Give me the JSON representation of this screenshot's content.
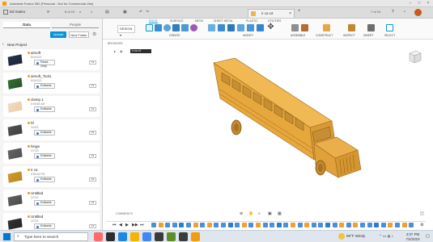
{
  "app": {
    "title": "Autodesk Fusion 360 (Personal - Not for Commercial Use)",
    "team": "Ed mateo",
    "page_counter": "8 of 10",
    "doc_tab": "ir ca v2",
    "doc_counter": "7 of 10"
  },
  "left_panel": {
    "tabs": [
      "Data",
      "People"
    ],
    "upload": "Upload",
    "new_folder": "New Folder",
    "breadcrumb": "New Project",
    "items": [
      {
        "name": "airsoft",
        "version": "8/4/1023",
        "badge": "Read-Only",
        "vb": "V1"
      },
      {
        "name": "airsoft_Tool1",
        "version": "8/4/1023",
        "badge": "Editable",
        "vb": "V1"
      },
      {
        "name": "clamp 1",
        "version": "8:55:58 AM",
        "badge": "Editable",
        "vb": "V1"
      },
      {
        "name": "hf",
        "version": "3/4/23",
        "badge": "Editable",
        "vb": "V1"
      },
      {
        "name": "hinge",
        "version": "2/7/23",
        "badge": "Editable",
        "vb": "V1"
      },
      {
        "name": "ir ca",
        "version": "8:56:18 PM",
        "badge": "Editable",
        "vb": "V2"
      },
      {
        "name": "Untitled",
        "version": "2/7/23",
        "badge": "Editable",
        "vb": "V1"
      },
      {
        "name": "Untitled",
        "version": "2/7/23",
        "badge": "Editable",
        "vb": "V1"
      }
    ]
  },
  "toolbar": {
    "workspace": "DESIGN",
    "tabs": [
      "SOLID",
      "SURFACE",
      "MESH",
      "SHEET METAL",
      "PLASTIC",
      "UTILITIES"
    ],
    "groups": [
      "CREATE",
      "MODIFY",
      "ASSEMBLE",
      "CONSTRUCT",
      "INSPECT",
      "INSERT",
      "SELECT"
    ]
  },
  "browser": {
    "label": "BROWSER",
    "node": "ir ca v2"
  },
  "comments": "COMMENTS",
  "taskbar": {
    "search": "Type here to search",
    "weather": "99°F  Windy",
    "time": "4:07 PM",
    "date": "7/4/2023"
  },
  "colors": {
    "accent": "#0696d7",
    "bus": "#e6a73c",
    "bus_dark": "#b97a24"
  }
}
